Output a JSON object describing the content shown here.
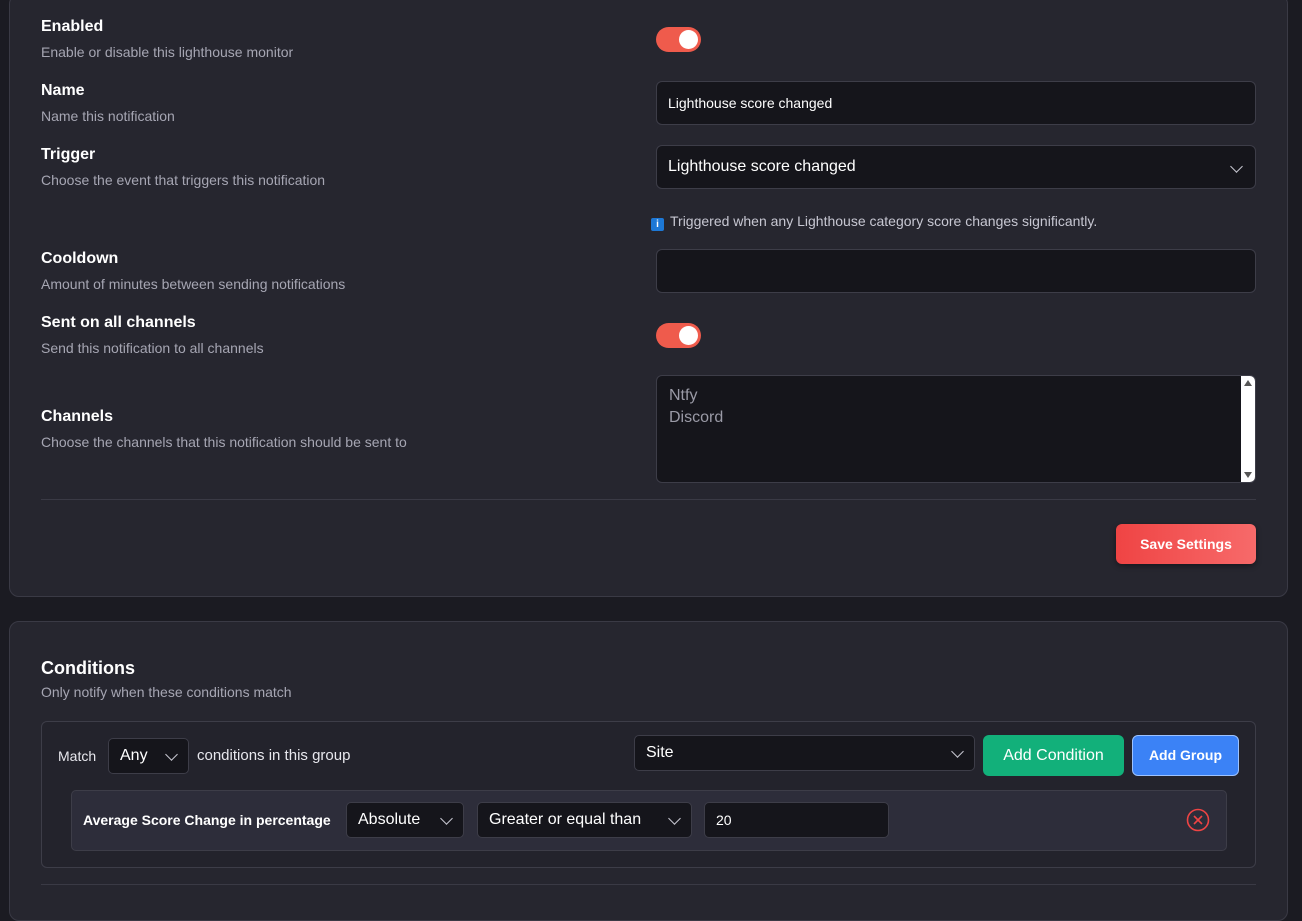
{
  "settings": {
    "enabled": {
      "title": "Enabled",
      "description": "Enable or disable this lighthouse monitor",
      "on": true
    },
    "name": {
      "title": "Name",
      "description": "Name this notification",
      "value": "Lighthouse score changed"
    },
    "trigger": {
      "title": "Trigger",
      "description": "Choose the event that triggers this notification",
      "value": "Lighthouse score changed",
      "hint_icon": "info-icon",
      "hint": "Triggered when any Lighthouse category score changes significantly."
    },
    "cooldown": {
      "title": "Cooldown",
      "description": "Amount of minutes between sending notifications",
      "value": ""
    },
    "all_channels": {
      "title": "Sent on all channels",
      "description": "Send this notification to all channels",
      "on": true
    },
    "channels": {
      "title": "Channels",
      "description": "Choose the channels that this notification should be sent to",
      "options": [
        "Ntfy",
        "Discord"
      ]
    },
    "save_label": "Save Settings"
  },
  "conditions": {
    "title": "Conditions",
    "description": "Only notify when these conditions match",
    "match_label": "Match",
    "match_value": "Any",
    "match_suffix": "conditions in this group",
    "field_select": "Site",
    "add_condition_label": "Add Condition",
    "add_group_label": "Add Group",
    "rule": {
      "label": "Average Score Change in percentage",
      "mode": "Absolute",
      "operator": "Greater or equal than",
      "value": "20"
    }
  },
  "colors": {
    "toggle_on": "#ef5b4c",
    "save_button": "#ef4444",
    "add_condition": "#12b07a",
    "add_group": "#3b82f6",
    "remove": "#ef4444"
  }
}
